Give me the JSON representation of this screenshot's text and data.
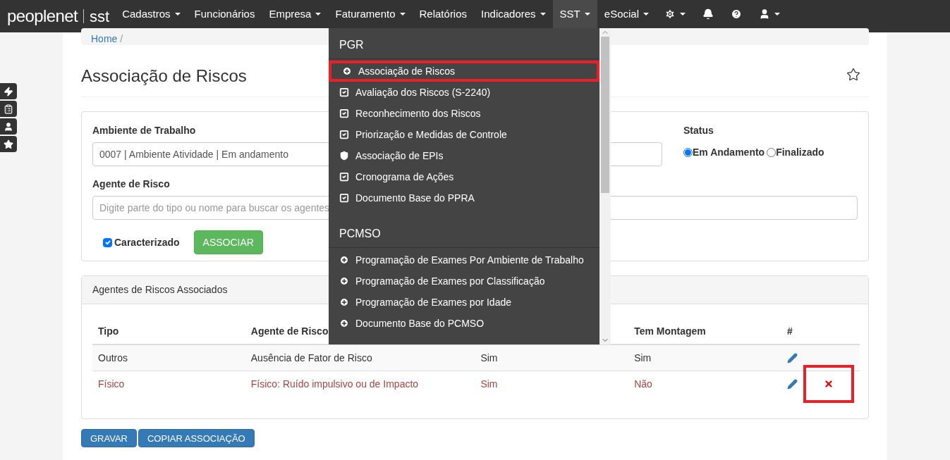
{
  "navbar": {
    "logo": "peoplenet",
    "logo_suffix": "sst",
    "items": [
      {
        "label": "Cadastros",
        "caret": true,
        "selected": false
      },
      {
        "label": "Funcionários",
        "caret": false,
        "selected": false
      },
      {
        "label": "Empresa",
        "caret": true,
        "selected": false
      },
      {
        "label": "Faturamento",
        "caret": true,
        "selected": false
      },
      {
        "label": "Relatórios",
        "caret": false,
        "selected": false
      },
      {
        "label": "Indicadores",
        "caret": true,
        "selected": false
      },
      {
        "label": "SST",
        "caret": true,
        "selected": true
      },
      {
        "label": "eSocial",
        "caret": true,
        "selected": false
      }
    ],
    "icons": [
      {
        "kind": "settings",
        "caret": true
      },
      {
        "kind": "notifications",
        "caret": false
      },
      {
        "kind": "help",
        "caret": false
      },
      {
        "kind": "account",
        "caret": true
      }
    ]
  },
  "side_tabs": [
    {
      "kind": "bolt"
    },
    {
      "kind": "clipboard"
    },
    {
      "kind": "user"
    },
    {
      "kind": "star"
    }
  ],
  "breadcrumb": [
    {
      "label": "Home",
      "separator": "/"
    }
  ],
  "page_title": "Associação de Riscos",
  "form": {
    "ambiente_label": "Ambiente de Trabalho",
    "ambiente_value": "0007 | Ambiente Atividade | Em andamento",
    "status_label": "Status",
    "status_options": [
      {
        "label": "Em Andamento",
        "selected": true
      },
      {
        "label": "Finalizado",
        "selected": false
      }
    ],
    "agente_label": "Agente de Risco",
    "agente_placeholder": "Digite parte do tipo ou nome para buscar os agentes",
    "caracterizado": {
      "label": "Caracterizado",
      "checked": true
    },
    "associar_button": "ASSOCIAR"
  },
  "table_panel": {
    "title": "Agentes de Riscos Associados",
    "columns": [
      {
        "label": "Tipo"
      },
      {
        "label": "Agente de Risco"
      },
      {},
      {
        "label": "Tem Montagem"
      },
      {
        "label": "#"
      }
    ],
    "rows": [
      {
        "cells": [
          "Outros",
          "Ausência de Fator de Risco",
          "Sim",
          "Sim"
        ],
        "flagged": false,
        "delete": false,
        "highlighted": false
      },
      {
        "cells": [
          "Físico",
          "Físico: Ruído impulsivo ou de Impacto",
          "Sim",
          "Não"
        ],
        "flagged": true,
        "delete": true,
        "highlighted": true
      }
    ]
  },
  "buttons": [
    "GRAVAR",
    "COPIAR ASSOCIAÇÃO"
  ],
  "dropdown": {
    "sections": [
      {
        "title": "PGR",
        "items": [
          {
            "label": "Associação de Riscos",
            "kind": "plus",
            "highlighted": true
          },
          {
            "label": "Avaliação dos Riscos (S-2240)",
            "kind": "check",
            "highlighted": false
          },
          {
            "label": "Reconhecimento dos Riscos",
            "kind": "check",
            "highlighted": false
          },
          {
            "label": "Priorização e Medidas de Controle",
            "kind": "check",
            "highlighted": false
          },
          {
            "label": "Associação de EPIs",
            "kind": "shield",
            "highlighted": false
          },
          {
            "label": "Cronograma de Ações",
            "kind": "check",
            "highlighted": false
          },
          {
            "label": "Documento Base do PPRA",
            "kind": "check",
            "highlighted": false
          }
        ]
      },
      {
        "title": "PCMSO",
        "items": [
          {
            "label": "Programação de Exames Por Ambiente de Trabalho",
            "kind": "plus",
            "highlighted": false
          },
          {
            "label": "Programação de Exames por Classificação",
            "kind": "plus",
            "highlighted": false
          },
          {
            "label": "Programação de Exames por Idade",
            "kind": "plus",
            "highlighted": false
          },
          {
            "label": "Documento Base do PCMSO",
            "kind": "plus",
            "highlighted": false
          }
        ]
      }
    ]
  }
}
